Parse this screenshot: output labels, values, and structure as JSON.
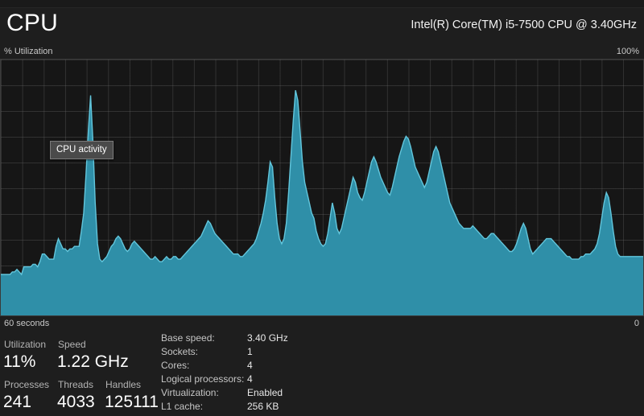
{
  "header": {
    "title": "CPU",
    "cpu_model": "Intel(R) Core(TM) i5-7500 CPU @ 3.40GHz"
  },
  "graph": {
    "y_axis_label": "% Utilization",
    "y_axis_max": "100%",
    "x_axis_start": "60 seconds",
    "x_axis_end": "0",
    "tooltip": "CPU activity",
    "colors": {
      "fill": "#2f8fa8",
      "stroke": "#62c6dc",
      "background": "#161616",
      "grid": "#3a3a3a",
      "panel": "#1e1e1e"
    }
  },
  "stats": {
    "utilization": {
      "label": "Utilization",
      "value": "11%"
    },
    "speed": {
      "label": "Speed",
      "value": "1.22 GHz"
    },
    "processes": {
      "label": "Processes",
      "value": "241"
    },
    "threads": {
      "label": "Threads",
      "value": "4033"
    },
    "handles": {
      "label": "Handles",
      "value": "125111"
    }
  },
  "details": [
    {
      "key": "Base speed:",
      "value": "3.40 GHz"
    },
    {
      "key": "Sockets:",
      "value": "1"
    },
    {
      "key": "Cores:",
      "value": "4"
    },
    {
      "key": "Logical processors:",
      "value": "4"
    },
    {
      "key": "Virtualization:",
      "value": "Enabled"
    },
    {
      "key": "L1 cache:",
      "value": "256 KB"
    }
  ],
  "chart_data": {
    "type": "area",
    "title": "CPU activity",
    "xlabel": "60 seconds",
    "ylabel": "% Utilization",
    "ylim": [
      0,
      100
    ],
    "xlim": [
      60,
      0
    ],
    "grid": true,
    "legend": "none",
    "series": [
      {
        "name": "CPU utilization",
        "values": [
          16,
          16,
          16,
          16,
          16,
          17,
          17,
          18,
          17,
          16,
          19,
          19,
          19,
          19,
          20,
          20,
          19,
          21,
          24,
          24,
          23,
          22,
          22,
          22,
          27,
          30,
          28,
          26,
          26,
          25,
          26,
          26,
          27,
          27,
          27,
          33,
          40,
          55,
          72,
          86,
          68,
          44,
          28,
          22,
          21,
          22,
          23,
          25,
          27,
          28,
          30,
          31,
          30,
          28,
          26,
          25,
          26,
          28,
          29,
          28,
          27,
          26,
          25,
          24,
          23,
          22,
          22,
          23,
          22,
          21,
          21,
          22,
          23,
          22,
          22,
          23,
          23,
          22,
          22,
          23,
          24,
          25,
          26,
          27,
          28,
          29,
          30,
          31,
          33,
          35,
          37,
          36,
          34,
          32,
          31,
          30,
          29,
          28,
          27,
          26,
          25,
          24,
          24,
          24,
          23,
          23,
          24,
          25,
          26,
          27,
          28,
          30,
          33,
          36,
          40,
          45,
          52,
          60,
          58,
          46,
          36,
          30,
          28,
          30,
          36,
          48,
          62,
          76,
          88,
          84,
          72,
          60,
          52,
          48,
          44,
          40,
          38,
          33,
          30,
          28,
          27,
          28,
          32,
          38,
          44,
          40,
          34,
          32,
          34,
          38,
          42,
          46,
          50,
          54,
          52,
          48,
          46,
          45,
          48,
          52,
          56,
          60,
          62,
          60,
          57,
          54,
          52,
          50,
          48,
          47,
          50,
          54,
          58,
          62,
          65,
          68,
          70,
          69,
          66,
          62,
          58,
          56,
          54,
          52,
          50,
          52,
          56,
          60,
          64,
          66,
          64,
          60,
          56,
          52,
          48,
          44,
          42,
          40,
          38,
          36,
          35,
          34,
          34,
          34,
          34,
          35,
          34,
          33,
          32,
          31,
          30,
          30,
          31,
          32,
          32,
          31,
          30,
          29,
          28,
          27,
          26,
          25,
          25,
          26,
          28,
          31,
          34,
          36,
          34,
          30,
          26,
          24,
          25,
          26,
          27,
          28,
          29,
          30,
          30,
          30,
          29,
          28,
          27,
          26,
          25,
          24,
          23,
          23,
          22,
          22,
          22,
          22,
          23,
          23,
          24,
          24,
          24,
          25,
          26,
          28,
          32,
          38,
          44,
          48,
          46,
          40,
          33,
          27,
          24,
          23,
          23,
          23,
          23,
          23,
          23,
          23,
          23,
          23,
          23,
          23
        ]
      }
    ]
  }
}
